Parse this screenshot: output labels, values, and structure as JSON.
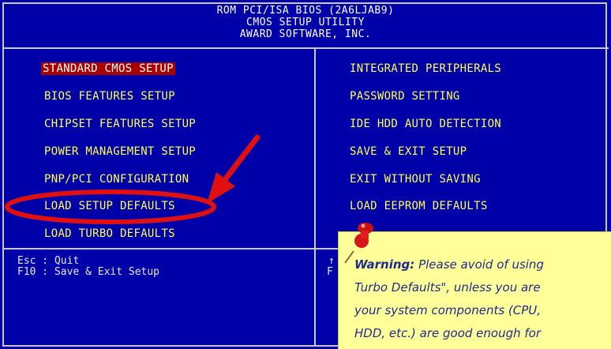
{
  "header": {
    "line1": "ROM PCI/ISA BIOS (2A6LJAB9)",
    "line2": "CMOS SETUP UTILITY",
    "line3": "AWARD SOFTWARE, INC."
  },
  "menu": {
    "left": [
      {
        "label": "STANDARD CMOS SETUP",
        "selected": true
      },
      {
        "label": "BIOS FEATURES SETUP"
      },
      {
        "label": "CHIPSET FEATURES SETUP"
      },
      {
        "label": "POWER MANAGEMENT SETUP"
      },
      {
        "label": "PNP/PCI CONFIGURATION"
      },
      {
        "label": "LOAD SETUP DEFAULTS"
      },
      {
        "label": "LOAD TURBO DEFAULTS"
      }
    ],
    "right": [
      {
        "label": "INTEGRATED PERIPHERALS"
      },
      {
        "label": "PASSWORD SETTING"
      },
      {
        "label": "IDE HDD AUTO DETECTION"
      },
      {
        "label": "SAVE & EXIT SETUP"
      },
      {
        "label": "EXIT WITHOUT SAVING"
      },
      {
        "label": "LOAD EEPROM DEFAULTS"
      }
    ]
  },
  "help": {
    "line1": "Esc : Quit",
    "line2": "F10 : Save & Exit Setup",
    "right_arrow": "↑",
    "right_key": "F"
  },
  "note": {
    "bold": "Warning:",
    "line1_rest": " Please avoid of using",
    "line2": "Turbo Defaults\", unless you are",
    "line3": "your system components (CPU,",
    "line4": "HDD, etc.) are good enough for"
  },
  "colors": {
    "background": "#0000a8",
    "menu_text": "#ffff55",
    "highlight": "#a80000",
    "annotation": "#e01010",
    "note_bg": "#ffff99"
  },
  "icons": [
    "pushpin-icon",
    "arrow-annotation",
    "ellipse-annotation"
  ]
}
